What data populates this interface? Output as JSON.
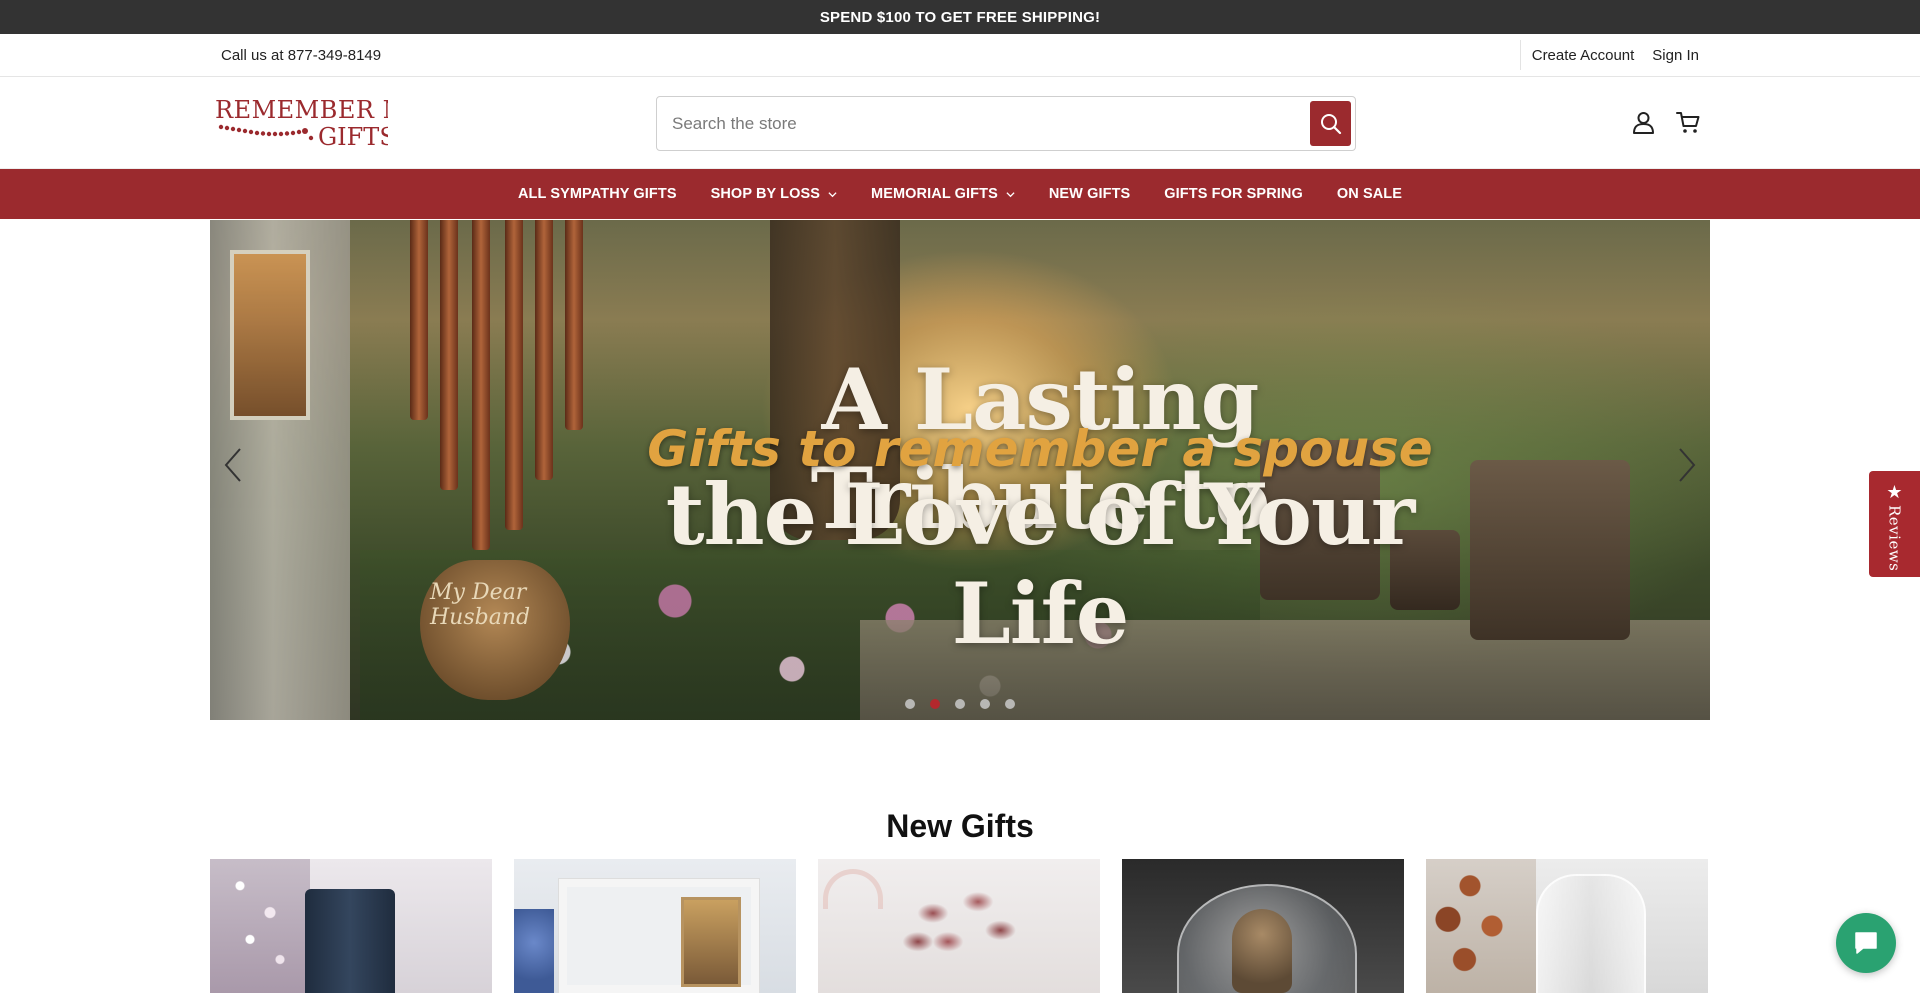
{
  "promo": {
    "text": "SPEND $100 TO GET FREE SHIPPING!"
  },
  "utility": {
    "phone_text": "Call us at 877-349-8149",
    "create_account": "Create Account",
    "sign_in": "Sign In"
  },
  "header": {
    "logo": {
      "line1": "Remember Me",
      "line2": "Gifts",
      "color": "#9b2a2e"
    },
    "search": {
      "placeholder": "Search the store",
      "value": ""
    },
    "icons": [
      "search-icon",
      "account-icon",
      "cart-icon"
    ]
  },
  "nav": {
    "items": [
      {
        "label": "ALL SYMPATHY GIFTS",
        "dropdown": false
      },
      {
        "label": "SHOP BY LOSS",
        "dropdown": true
      },
      {
        "label": "MEMORIAL GIFTS",
        "dropdown": true
      },
      {
        "label": "NEW GIFTS",
        "dropdown": false
      },
      {
        "label": "GIFTS FOR SPRING",
        "dropdown": false
      },
      {
        "label": "ON SALE",
        "dropdown": false
      }
    ]
  },
  "hero": {
    "line1": "A Lasting Tribute to",
    "line2": "Gifts to remember a spouse",
    "line3": "the Love of Your Life",
    "ornament_text": "My Dear Husband",
    "slides": 5,
    "active_slide": 2
  },
  "new_gifts": {
    "title": "New Gifts"
  },
  "reviews_tab": {
    "label": "Reviews"
  },
  "colors": {
    "brand": "#9b2a2e",
    "promo_bg": "#333333",
    "dot_active": "#b3282d",
    "chat": "#2aa271"
  }
}
